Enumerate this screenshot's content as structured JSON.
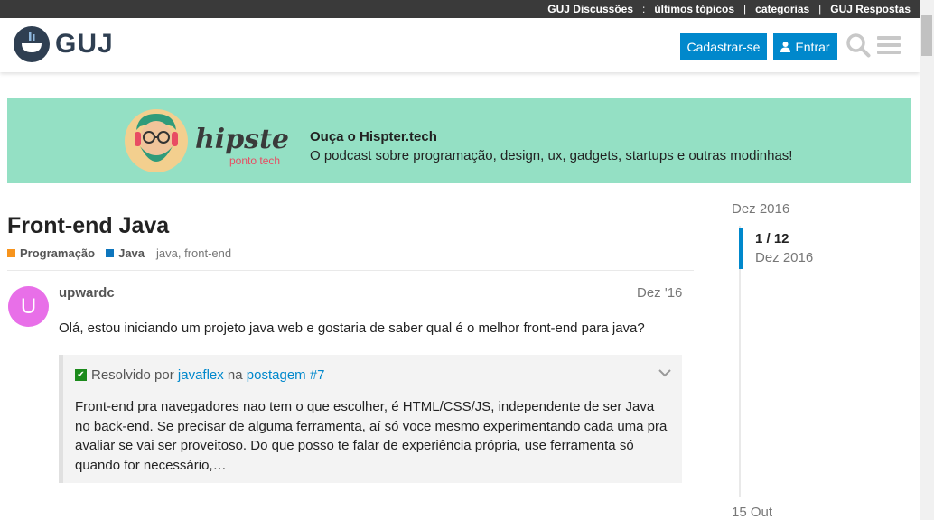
{
  "topnav": {
    "items": [
      "GUJ Discussões",
      "últimos tópicos",
      "categorias",
      "GUJ Respostas"
    ],
    "separators": [
      ":",
      "|",
      "|"
    ]
  },
  "header": {
    "logo_text": "GUJ",
    "signup_label": "Cadastrar-se",
    "login_label": "Entrar",
    "icons": [
      "search-icon",
      "menu-icon"
    ]
  },
  "banner": {
    "image_text": "hipsters",
    "image_subtext": "ponto tech",
    "title": "Ouça o Hispter.tech",
    "description": "O podcast sobre programação, design, ux, gadgets, startups e outras modinhas!",
    "background": "#94e0c4"
  },
  "topic": {
    "title": "Front-end Java",
    "categories": [
      {
        "name": "Programação",
        "color": "#f7941d"
      },
      {
        "name": "Java",
        "color": "#0e76bd"
      }
    ],
    "tags": "java, front-end"
  },
  "post": {
    "avatar_letter": "U",
    "username": "upwardc",
    "date": "Dez '16",
    "body": "Olá, estou iniciando um projeto java web e gostaria de saber qual é o melhor front-end para java?"
  },
  "solution": {
    "prefix": "Resolvido por",
    "author": "javaflex",
    "mid": "na",
    "link": "postagem #7",
    "body": "Front-end pra navegadores nao tem o que escolher, é HTML/CSS/JS, independente de ser Java no back-end. Se precisar de alguma ferramenta, aí só voce mesmo experimentando cada uma pra avaliar se vai ser proveitoso. Do que posso te falar de experiência própria, use ferramenta só quando for necessário,…"
  },
  "timeline": {
    "start": "Dez 2016",
    "position": "1 / 12",
    "current_date": "Dez 2016",
    "end": "15 Out"
  },
  "colors": {
    "accent": "#0088cc",
    "topbar": "#3a3a3a",
    "avatar": "#e86fe8",
    "solved": "#1b8a1b"
  }
}
